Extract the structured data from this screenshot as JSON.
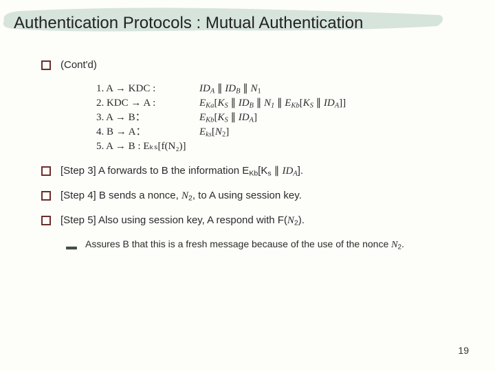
{
  "title": "Authentication Protocols : Mutual Authentication",
  "contd": "(Cont'd)",
  "protocol": {
    "lines": [
      {
        "lhs": "1. A → KDC :",
        "rhs_html": "<span class='sub-italic'>ID<sub>A</sub></span> ∥ <span class='sub-italic'>ID<sub>B</sub></span> ∥ <span class='sub-italic'>N</span><sub>1</sub>"
      },
      {
        "lhs": "2. KDC → A :",
        "rhs_html": "<span class='sub-italic'>E<sub>Ka</sub></span>[<span class='sub-italic'>K<sub>S</sub></span> ∥ <span class='sub-italic'>ID<sub>B</sub></span> ∥ <span class='sub-italic'>N<sub>1</sub></span> ∥ <span class='sub-italic'>E<sub>Kb</sub></span>[<span class='sub-italic'>K<sub>S</sub></span> ∥ <span class='sub-italic'>ID<sub>A</sub></span>]]"
      },
      {
        "lhs": "3. A → B：",
        "rhs_html": "<span class='sub-italic'>E<sub>Kb</sub></span>[<span class='sub-italic'>K<sub>S</sub></span> ∥ <span class='sub-italic'>ID<sub>A</sub></span>]"
      },
      {
        "lhs": "4. B → A：",
        "rhs_html": "<span class='sub-italic'>E<sub>ks</sub></span>[<span class='sub-italic'>N</span><sub>2</sub>]"
      },
      {
        "lhs": "5. A → B : Eₖₛ[f(N₂)]",
        "rhs_html": ""
      }
    ]
  },
  "step3_html": "[Step 3] A forwards to B the information E<sub>Kb</sub>[K<sub>s</sub> ∥ <span class='sub-italic'>ID<sub>A</sub></span>].",
  "step4_html": "[Step 4] B sends a nonce, <span class='sub-italic'>N</span><sub>2</sub>, to A using session key.",
  "step5_html": "[Step 5] Also using session key, A respond with F(<span class='sub-italic'>N</span><sub>2</sub>).",
  "sub_html": "Assures B that this is a fresh message because of the use of the nonce <span class='sub-italic'>N</span><sub>2</sub>.",
  "page_number": "19"
}
